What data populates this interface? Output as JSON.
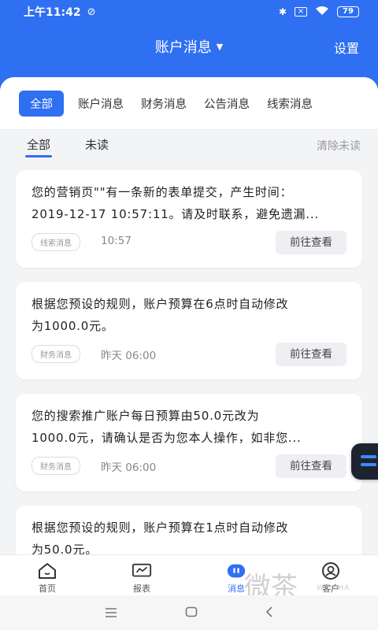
{
  "status_bar": {
    "time": "上午11:42",
    "battery": "79"
  },
  "header": {
    "title": "账户消息",
    "settings_label": "设置"
  },
  "category_tabs": [
    "全部",
    "账户消息",
    "财务消息",
    "公告消息",
    "线索消息"
  ],
  "read_tabs": {
    "all": "全部",
    "unread": "未读",
    "clear_unread": "清除未读"
  },
  "messages": [
    {
      "line1": "您的营销页\"\"有一条新的表单提交，产生时间：",
      "line2": "2019-12-17 10:57:11。请及时联系，避免遗漏...",
      "tag": "线索消息",
      "time": "10:57",
      "action": "前往查看"
    },
    {
      "line1": "根据您预设的规则，账户预算在6点时自动修改",
      "line2": "为1000.0元。",
      "tag": "财务消息",
      "time": "昨天  06:00",
      "action": "前往查看"
    },
    {
      "line1": "您的搜索推广账户每日预算由50.0元改为",
      "line2": "1000.0元，请确认是否为您本人操作，如非您...",
      "tag": "财务消息",
      "time": "昨天  06:00",
      "action": "前往查看"
    },
    {
      "line1": "根据您预设的规则，账户预算在1点时自动修改",
      "line2": "为50.0元。",
      "tag": "",
      "time": "",
      "action": ""
    }
  ],
  "bottom_nav": [
    {
      "label": "首页",
      "icon": "home-icon"
    },
    {
      "label": "报表",
      "icon": "report-icon"
    },
    {
      "label": "消息",
      "icon": "message-icon"
    },
    {
      "label": "客户",
      "icon": "user-icon"
    }
  ],
  "watermark": {
    "text": "微茶",
    "sub": "WEICHA"
  },
  "colors": {
    "accent": "#2f6ff2",
    "background": "#f3f4f6"
  }
}
